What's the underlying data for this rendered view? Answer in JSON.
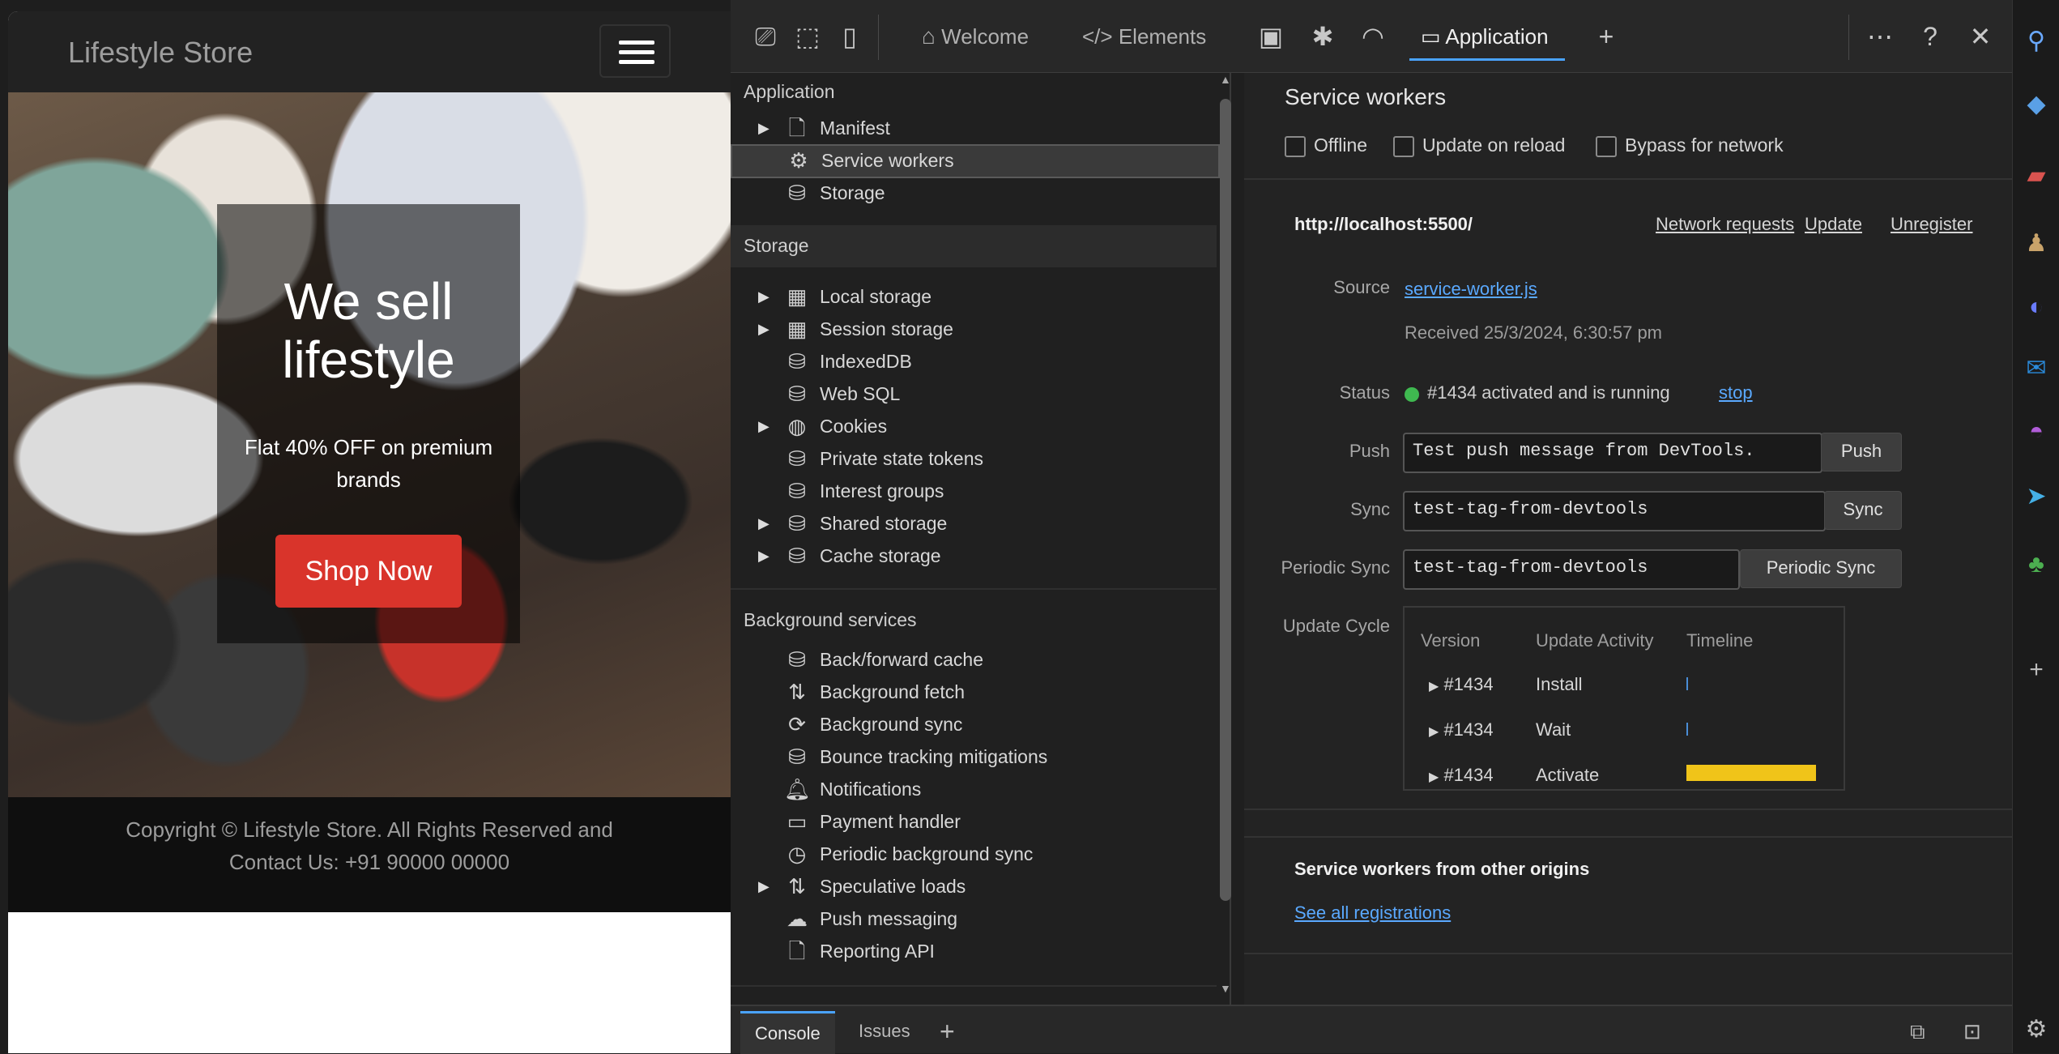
{
  "site": {
    "brand": "Lifestyle Store",
    "hero_title": "We sell lifestyle",
    "hero_subtitle": "Flat 40% OFF on premium brands",
    "cta_label": "Shop Now",
    "footer_line1": "Copyright © Lifestyle Store. All Rights Reserved and",
    "footer_line2": "Contact Us: +91 90000 00000"
  },
  "devtools": {
    "tabs": [
      {
        "label": "Welcome",
        "icon": "home-icon"
      },
      {
        "label": "Elements",
        "icon": "code-icon"
      },
      {
        "label": "Application",
        "icon": "application-icon",
        "active": true
      }
    ],
    "sidebar": {
      "application_title": "Application",
      "application_items": [
        {
          "label": "Manifest",
          "icon": "document-icon",
          "expandable": true
        },
        {
          "label": "Service workers",
          "icon": "service-worker-icon",
          "selected": true
        },
        {
          "label": "Storage",
          "icon": "database-icon"
        }
      ],
      "storage_title": "Storage",
      "storage_items": [
        {
          "label": "Local storage",
          "icon": "grid-icon",
          "expandable": true
        },
        {
          "label": "Session storage",
          "icon": "grid-icon",
          "expandable": true
        },
        {
          "label": "IndexedDB",
          "icon": "database-icon"
        },
        {
          "label": "Web SQL",
          "icon": "database-icon"
        },
        {
          "label": "Cookies",
          "icon": "cookie-icon",
          "expandable": true
        },
        {
          "label": "Private state tokens",
          "icon": "database-icon"
        },
        {
          "label": "Interest groups",
          "icon": "database-icon"
        },
        {
          "label": "Shared storage",
          "icon": "database-icon",
          "expandable": true
        },
        {
          "label": "Cache storage",
          "icon": "database-icon",
          "expandable": true
        }
      ],
      "background_title": "Background services",
      "background_items": [
        {
          "label": "Back/forward cache",
          "icon": "database-icon"
        },
        {
          "label": "Background fetch",
          "icon": "updown-arrows-icon"
        },
        {
          "label": "Background sync",
          "icon": "sync-icon"
        },
        {
          "label": "Bounce tracking mitigations",
          "icon": "database-icon"
        },
        {
          "label": "Notifications",
          "icon": "bell-icon"
        },
        {
          "label": "Payment handler",
          "icon": "card-icon"
        },
        {
          "label": "Periodic background sync",
          "icon": "clock-icon"
        },
        {
          "label": "Speculative loads",
          "icon": "updown-arrows-icon",
          "expandable": true
        },
        {
          "label": "Push messaging",
          "icon": "cloud-icon"
        },
        {
          "label": "Reporting API",
          "icon": "document-icon"
        }
      ]
    },
    "main": {
      "title": "Service workers",
      "options": [
        {
          "label": "Offline"
        },
        {
          "label": "Update on reload"
        },
        {
          "label": "Bypass for network"
        }
      ],
      "origin": "http://localhost:5500/",
      "origin_links": {
        "network": "Network requests",
        "update": "Update",
        "unregister": "Unregister"
      },
      "source_label": "Source",
      "source_link": "service-worker.js",
      "received": "Received 25/3/2024, 6:30:57 pm",
      "status_label": "Status",
      "status_text": "#1434 activated and is running",
      "status_color": "#3fb950",
      "stop_link": "stop",
      "push_label": "Push",
      "push_value": "Test push message from DevTools.",
      "push_button": "Push",
      "sync_label": "Sync",
      "sync_value": "test-tag-from-devtools",
      "sync_button": "Sync",
      "periodic_label": "Periodic Sync",
      "periodic_value": "test-tag-from-devtools",
      "periodic_button": "Periodic Sync",
      "update_cycle_label": "Update Cycle",
      "uc_headers": {
        "version": "Version",
        "activity": "Update Activity",
        "timeline": "Timeline"
      },
      "uc_rows": [
        {
          "version": "#1434",
          "activity": "Install"
        },
        {
          "version": "#1434",
          "activity": "Wait"
        },
        {
          "version": "#1434",
          "activity": "Activate"
        }
      ],
      "timeline_color": "#f0c419",
      "other_origins_title": "Service workers from other origins",
      "see_all_link": "See all registrations"
    },
    "drawer": {
      "console": "Console",
      "issues": "Issues"
    }
  }
}
